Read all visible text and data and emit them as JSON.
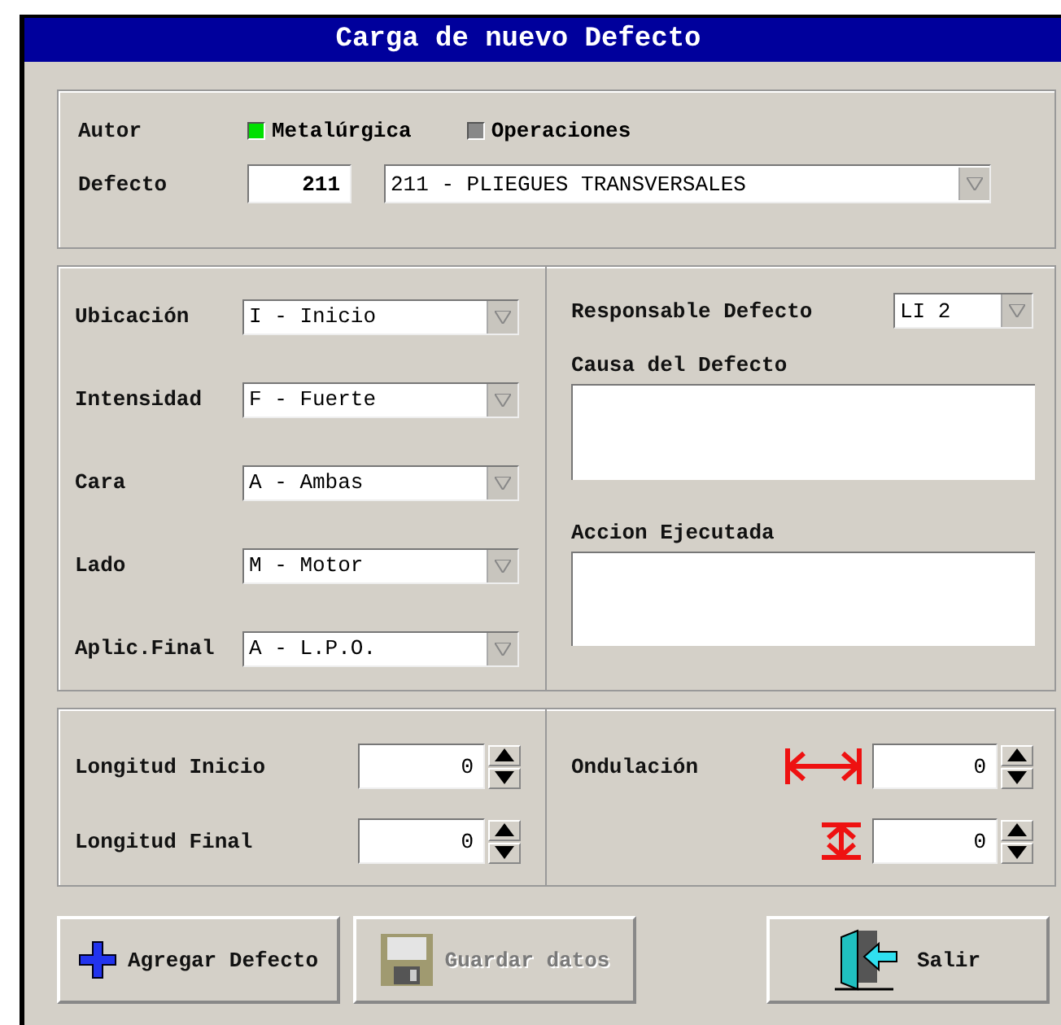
{
  "window": {
    "title": "Carga de nuevo Defecto"
  },
  "autor": {
    "label": "Autor",
    "options": [
      {
        "label": "Metalúrgica",
        "selected": true
      },
      {
        "label": "Operaciones",
        "selected": false
      }
    ]
  },
  "defecto": {
    "label": "Defecto",
    "code": "211",
    "value": "211 - PLIEGUES TRANSVERSALES"
  },
  "detail_fields": [
    {
      "label": "Ubicación",
      "value": "I - Inicio"
    },
    {
      "label": "Intensidad",
      "value": "F - Fuerte"
    },
    {
      "label": "Cara",
      "value": "A - Ambas"
    },
    {
      "label": "Lado",
      "value": "M - Motor"
    },
    {
      "label": "Aplic.Final",
      "value": "A - L.P.O."
    }
  ],
  "responsable": {
    "label": "Responsable Defecto",
    "value": "LI 2"
  },
  "text_areas": [
    {
      "label": "Causa del Defecto"
    },
    {
      "label": "Accion Ejecutada"
    }
  ],
  "longitud": [
    {
      "label": "Longitud Inicio",
      "value": "0"
    },
    {
      "label": "Longitud Final",
      "value": "0"
    }
  ],
  "ondulacion": {
    "label": "Ondulación",
    "fields": [
      {
        "kind": "width",
        "value": "0"
      },
      {
        "kind": "height",
        "value": "0"
      }
    ]
  },
  "buttons": [
    {
      "kind": "add",
      "label": "Agregar Defecto",
      "disabled": false
    },
    {
      "kind": "save",
      "label": "Guardar datos",
      "disabled": true
    },
    {
      "kind": "exit",
      "label": "Salir",
      "disabled": false
    }
  ]
}
